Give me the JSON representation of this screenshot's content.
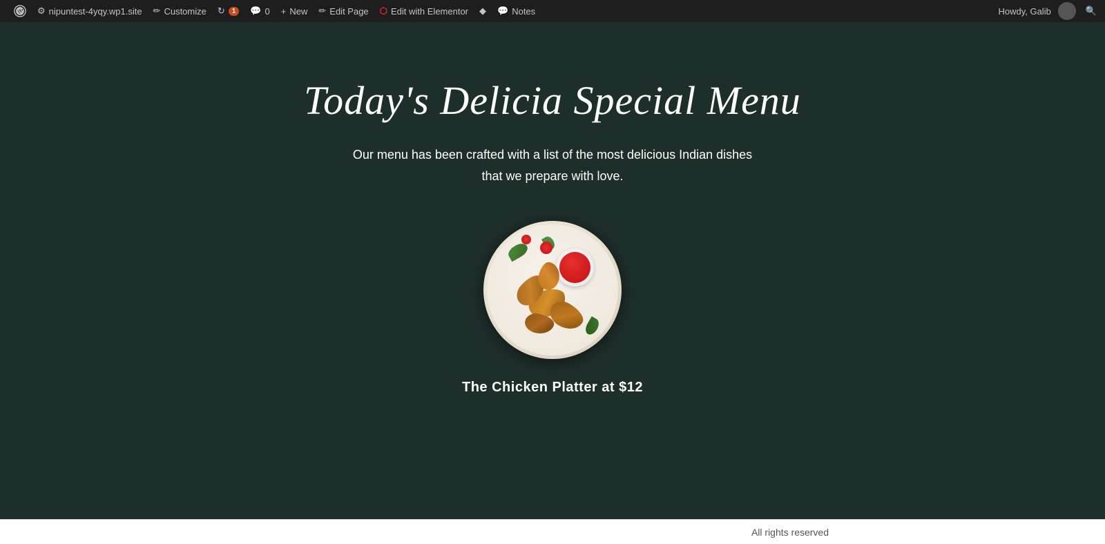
{
  "adminbar": {
    "site_url": "nipuntest-4yqy.wp1.site",
    "customize_label": "Customize",
    "updates_count": "1",
    "comments_count": "0",
    "new_label": "New",
    "edit_page_label": "Edit Page",
    "edit_with_elementor_label": "Edit with Elementor",
    "notes_label": "Notes",
    "howdy_label": "Howdy, Galib"
  },
  "main": {
    "page_title": "Today's Delicia Special Menu",
    "subtitle_line1": "Our menu has been crafted with a list of the most delicious Indian dishes",
    "subtitle_line2": "that we prepare with love.",
    "dish_label": "The Chicken Platter at $12"
  },
  "footer": {
    "text": "All rights reserved"
  }
}
